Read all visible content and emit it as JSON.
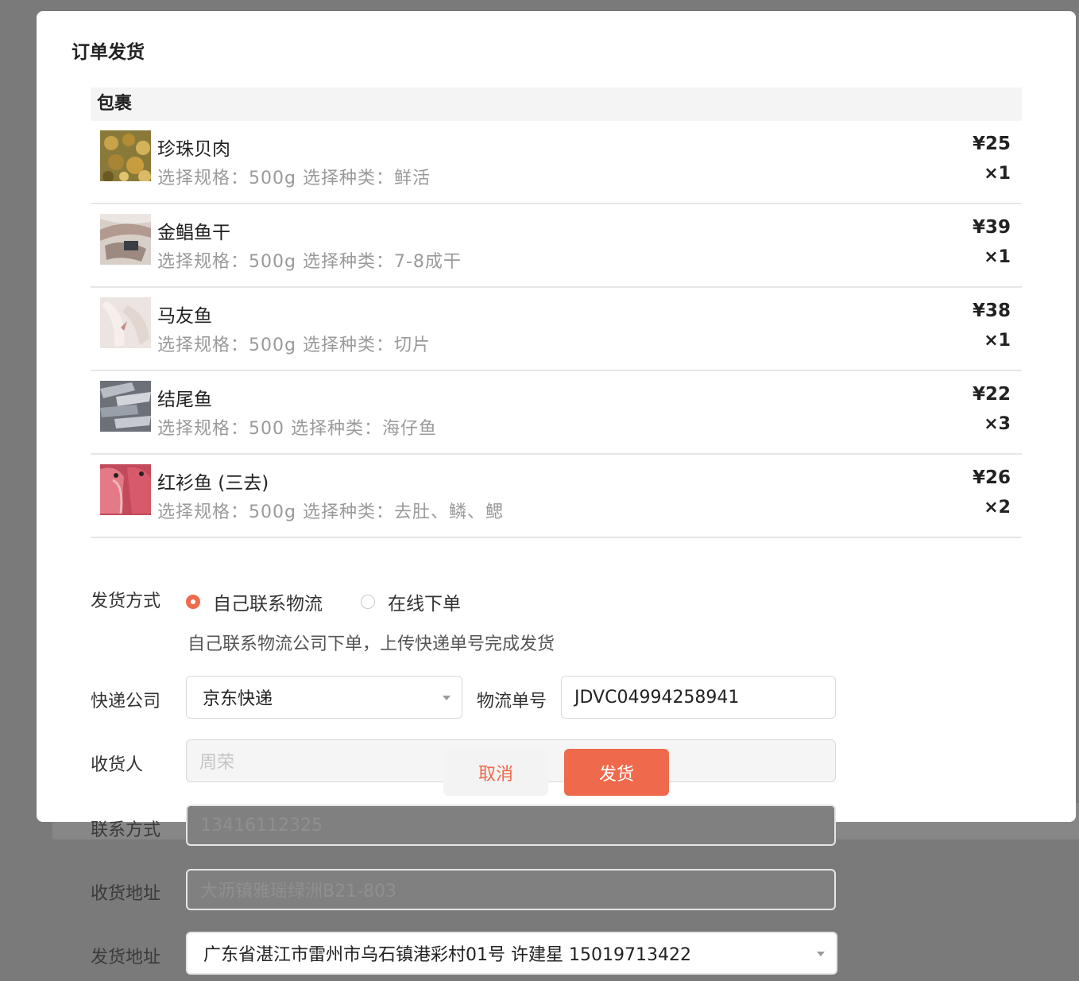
{
  "modal": {
    "title": "订单发货"
  },
  "package": {
    "header": "包裹",
    "items": [
      {
        "name": "珍珠贝肉",
        "spec": "选择规格：500g  选择种类：鲜活",
        "price": "¥25",
        "qty": "×1"
      },
      {
        "name": "金鲳鱼干",
        "spec": "选择规格：500g  选择种类：7-8成干",
        "price": "¥39",
        "qty": "×1"
      },
      {
        "name": "马友鱼",
        "spec": "选择规格：500g  选择种类：切片",
        "price": "¥38",
        "qty": "×1"
      },
      {
        "name": "结尾鱼",
        "spec": "选择规格：500  选择种类：海仔鱼",
        "price": "¥22",
        "qty": "×3"
      },
      {
        "name": "红衫鱼 (三去)",
        "spec": "选择规格：500g  选择种类：去肚、鳞、鳃",
        "price": "¥26",
        "qty": "×2"
      }
    ]
  },
  "shipping": {
    "method_label": "发货方式",
    "option_self": "自己联系物流",
    "option_online": "在线下单",
    "selected": "自己联系物流",
    "hint": "自己联系物流公司下单，上传快递单号完成发货",
    "courier_label": "快递公司",
    "courier_value": "京东快递",
    "tracking_label": "物流单号",
    "tracking_value": "JDVC04994258941",
    "receiver_label": "收货人",
    "receiver_value": "周荣",
    "phone_label": "联系方式",
    "phone_value": "13416112325",
    "address_label": "收货地址",
    "address_value": "大沥镇雅瑶绿洲B21-803",
    "sender_label": "发货地址",
    "sender_value": "广东省湛江市雷州市乌石镇港彩村01号 许建星 15019713422"
  },
  "actions": {
    "cancel": "取消",
    "submit": "发货"
  },
  "colors": {
    "accent": "#ef6a4c",
    "overlay": "#7a7a7a"
  },
  "icons": {
    "select_caret": "caret-down-icon",
    "radio_on": "radio-checked-icon",
    "radio_off": "radio-unchecked-icon"
  }
}
